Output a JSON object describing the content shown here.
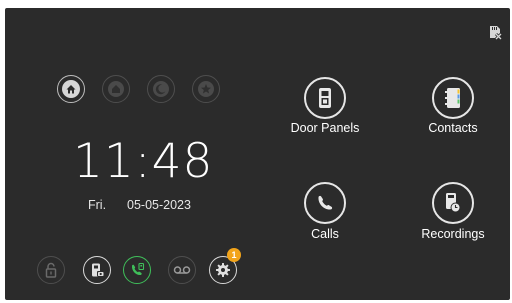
{
  "status_bar": {
    "icon": "sd-card-removed-icon"
  },
  "modes": [
    {
      "name": "home",
      "icon": "home-icon",
      "active": true
    },
    {
      "name": "away",
      "icon": "away-icon",
      "active": false
    },
    {
      "name": "night",
      "icon": "moon-icon",
      "active": false
    },
    {
      "name": "custom",
      "icon": "star-icon",
      "active": false
    }
  ],
  "clock": {
    "time": "11:48",
    "day": "Fri.",
    "date": "05-05-2023"
  },
  "apps": {
    "door_panels": {
      "label": "Door Panels",
      "icon": "door-panel-icon"
    },
    "contacts": {
      "label": "Contacts",
      "icon": "contacts-book-icon"
    },
    "calls": {
      "label": "Calls",
      "icon": "phone-handset-icon"
    },
    "recordings": {
      "label": "Recordings",
      "icon": "recording-clock-icon"
    }
  },
  "quick_actions": [
    {
      "name": "unlock",
      "icon": "lock-icon"
    },
    {
      "name": "snapshot",
      "icon": "door-camera-icon"
    },
    {
      "name": "intercom-call",
      "icon": "phone-intercom-icon",
      "color": "#3fbf5a"
    },
    {
      "name": "voicemail",
      "icon": "voicemail-icon"
    },
    {
      "name": "settings",
      "icon": "gear-icon"
    }
  ],
  "settings_badge": {
    "count": "1",
    "color": "#f2a41a"
  },
  "colors": {
    "background": "#2b2b2b",
    "accent_green": "#3fbf5a",
    "badge": "#f2a41a"
  }
}
